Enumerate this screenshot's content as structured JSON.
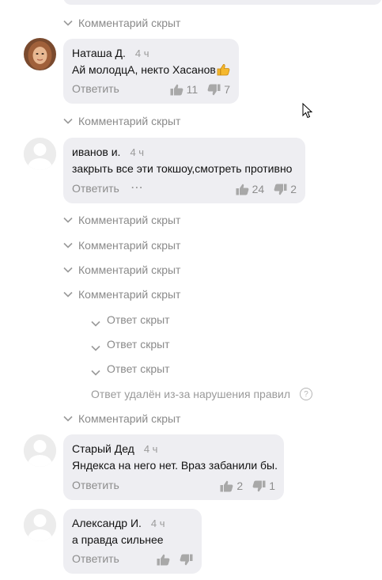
{
  "comments": [
    {
      "author": "Наташа Д.",
      "time": "4 ч",
      "text": "Ай молодцА, некто Хасанов",
      "reply_label": "Ответить",
      "likes": "11",
      "dislikes": "7"
    },
    {
      "author": "иванов и.",
      "time": "4 ч",
      "text": "закрыть все эти токшоу,смотреть противно",
      "reply_label": "Ответить",
      "likes": "24",
      "dislikes": "2"
    },
    {
      "author": "Старый Дед",
      "time": "4 ч",
      "text": "Яндекса на него нет. Враз забанили бы.",
      "reply_label": "Ответить",
      "likes": "2",
      "dislikes": "1"
    },
    {
      "author": "Александр И.",
      "time": "4 ч",
      "text": "а правда сильнее",
      "reply_label": "Ответить"
    }
  ],
  "hidden_comment_label": "Комментарий скрыт",
  "hidden_reply_label": "Ответ скрыт",
  "deleted_reply_label": "Ответ удалён из-за нарушения правил",
  "help_glyph": "?",
  "more_glyph": "⋯",
  "thumbs_up_emoji_icon": "thumbs-up-emoji-icon",
  "colors": {
    "bubble": "#eeeef2",
    "muted_text": "#8d8d8d",
    "emoji": "#f5b82e"
  }
}
